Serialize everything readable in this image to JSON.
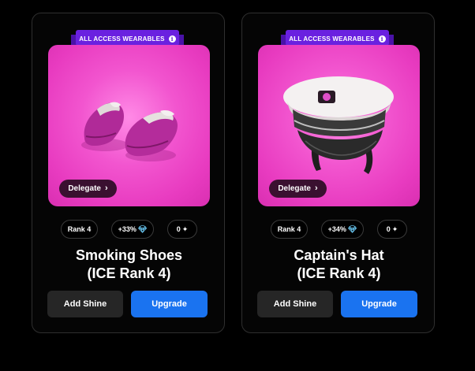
{
  "cards": [
    {
      "ribbon": "ALL ACCESS WEARABLES",
      "delegate_label": "Delegate",
      "rank": "Rank 4",
      "bonus": "+33%",
      "shine_count": "0",
      "name": "Smoking Shoes",
      "subtitle": "(ICE Rank 4)",
      "add_shine_label": "Add Shine",
      "upgrade_label": "Upgrade"
    },
    {
      "ribbon": "ALL ACCESS WEARABLES",
      "delegate_label": "Delegate",
      "rank": "Rank 4",
      "bonus": "+34%",
      "shine_count": "0",
      "name": "Captain's Hat",
      "subtitle": "(ICE Rank 4)",
      "add_shine_label": "Add Shine",
      "upgrade_label": "Upgrade"
    }
  ],
  "icons": {
    "info": "info-icon",
    "chevron": "chevron-right-icon",
    "gem": "diamond-icon",
    "sparkle": "sparkle-icon"
  },
  "colors": {
    "background": "#000000",
    "card_border": "#2f2f2f",
    "ribbon": "#6a21e0",
    "panel_pink": "#f255cf",
    "upgrade": "#1a73f0",
    "add_shine": "#262626"
  }
}
